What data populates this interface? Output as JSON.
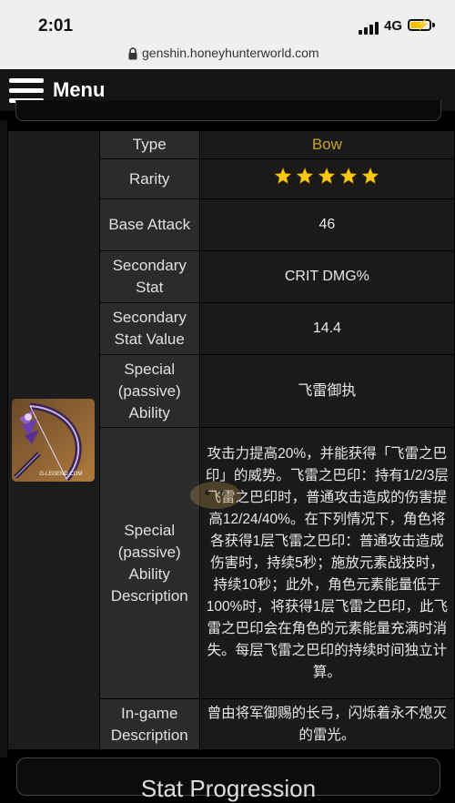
{
  "status_bar": {
    "time": "2:01",
    "network": "4G"
  },
  "browser": {
    "url": "genshin.honeyhunterworld.com"
  },
  "header": {
    "menu_label": "Menu"
  },
  "weapon": {
    "rows": [
      {
        "label": "Type",
        "value": "Bow"
      },
      {
        "label": "Rarity",
        "stars": 5
      },
      {
        "label": "Base Attack",
        "value": "46"
      },
      {
        "label": "Secondary Stat",
        "value": "CRIT DMG%"
      },
      {
        "label": "Secondary Stat Value",
        "value": "14.4"
      },
      {
        "label": "Special (passive) Ability",
        "value": "飞雷御执"
      },
      {
        "label": "Special (passive) Ability Description",
        "value": "攻击力提高20%，并能获得「飞雷之巴印」的威势。飞雷之巴印：持有1/2/3层飞雷之巴印时，普通攻击造成的伤害提高12/24/40%。在下列情况下，角色将各获得1层飞雷之巴印：普通攻击造成伤害时，持续5秒；施放元素战技时，持续10秒；此外，角色元素能量低于100%时，将获得1层飞雷之巴印，此飞雷之巴印会在角色的元素能量充满时消失。每层飞雷之巴印的持续时间独立计算。"
      },
      {
        "label": "In-game Description",
        "value": "曾由将军御赐的长弓，闪烁着永不熄灭的雷光。"
      }
    ],
    "image_caption": "G-LEGEND.COM"
  },
  "next_section": {
    "title": "Stat Progression"
  },
  "colors": {
    "type_value": "#c9a227",
    "star": "#f5c518",
    "header_bg": "#141414"
  }
}
